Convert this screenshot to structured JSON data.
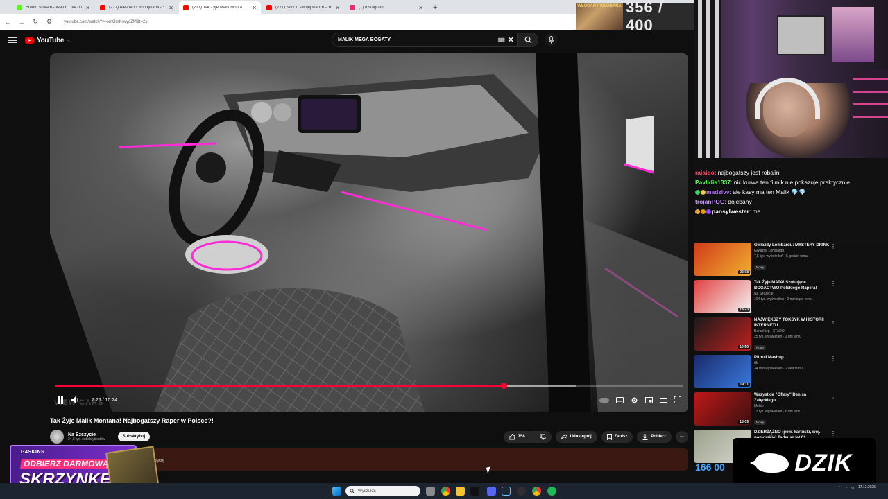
{
  "browser": {
    "tabs": [
      {
        "title": "Franio Stream - Watch Live on Kick",
        "color": "#53fc18",
        "active": false
      },
      {
        "title": "(217) Aleshen x miodykami - YouTube",
        "color": "#ff0000",
        "active": false
      },
      {
        "title": "(217) Tak Żyje Malik Monta...",
        "color": "#ff0000",
        "active": true
      },
      {
        "title": "(217) Nitrz o swojej wadze - YouTube",
        "color": "#ff0000",
        "active": false
      },
      {
        "title": "(1) Instagram",
        "color": "#e1306c",
        "active": false
      }
    ],
    "url": "youtube.com/watch?v=omOmKovydZM&t=2s",
    "new_tab": "+"
  },
  "overlay_counter": {
    "title": "WŁODARY WŁODARA",
    "value": "356 / 400"
  },
  "youtube": {
    "logo_text": "YouTube",
    "logo_country": "PL",
    "search_query": "MALIK MEGA BOGATY",
    "video": {
      "current_time": "7:26 / 10:24",
      "progress": 0.715,
      "watermark": "VIEW CARS",
      "title": "Tak Żyje Malik Montana! Najbogatszy Raper w Polsce?!"
    },
    "channel": {
      "name": "Na Szczycie",
      "subscribers": "24,6 tys. subskrybentów",
      "subscribe_label": "Subskrybuj"
    },
    "actions": {
      "likes": "758",
      "share": "Udostępnij",
      "save": "Zapisz",
      "download": "Pobierz"
    },
    "description_more": "...więcej"
  },
  "chat": [
    {
      "user": "rajaiqo",
      "color": "#ff4f6a",
      "text": ": najbogatszy jest robalini",
      "badges": []
    },
    {
      "user": "Pavlidis1337",
      "color": "#5bff5b",
      "text": ": nic kurwa ten filmik nie pokazuje praktycznie",
      "badges": []
    },
    {
      "user": "madzivv",
      "color": "#b36bff",
      "text": ": ale kasy ma ten Malik 💎💎",
      "badges": [
        "#3ad06a",
        "#f3c742"
      ]
    },
    {
      "user": "trojanPOG",
      "color": "#c690ff",
      "text": ": dojebany",
      "badges": []
    },
    {
      "user": "pansylwester",
      "color": "#ffffff",
      "text": ": ma",
      "badges": [
        "#f3a742",
        "#e0a000",
        "#9146ff"
      ]
    }
  ],
  "recommendations": [
    {
      "title": "Gwiazdy Lombardu: MYSTERY DRINK",
      "channel": "Gwiazdy Lombardu",
      "meta": "7,5 tys. wyświetleń · 5 godzin temu",
      "duration": "22:08",
      "new": "Nowy",
      "c1": "#d13a1a",
      "c2": "#f0b030"
    },
    {
      "title": "Tak Żyje MATA! Szokujące BOGACTWO Polskiego Rapera!",
      "channel": "Na Szczycie",
      "meta": "104 tys. wyświetleń · 2 miesiące temu",
      "duration": "18:23",
      "new": "",
      "c1": "#e04040",
      "c2": "#f5f5f5"
    },
    {
      "title": "NAJWIĘKSZY TOKSYK W HISTORII INTERNETU",
      "channel": "Barankiep - STADO",
      "meta": "25 tys. wyświetleń · 2 dni temu",
      "duration": "19:59",
      "new": "Nowy",
      "c1": "#1a1a1a",
      "c2": "#c02020"
    },
    {
      "title": "Pitbull Mashup",
      "channel": "dk",
      "meta": "34 mln wyświetleń · 2 lata temu",
      "duration": "19:11",
      "new": "",
      "c1": "#1a2a6a",
      "c2": "#3a7adf"
    },
    {
      "title": "Wszystkie \"Ofiary\" Denisa Załęckiego..",
      "channel": "Mehio",
      "meta": "73 tys. wyświetleń · 6 dni temu",
      "duration": "18:09",
      "new": "Nowy",
      "c1": "#c01818",
      "c2": "#3a1010"
    },
    {
      "title": "DZIERŻĄŻNO (pow. kartuski, woj. pomorskie) Tadeusz lat 61",
      "channel": "",
      "meta": "",
      "duration": "",
      "new": "",
      "c1": "#9aa08a",
      "c2": "#d8d8d0"
    }
  ],
  "promo": {
    "brand": "G4SKINS",
    "line1": "ODBIERZ DARMOWĄ",
    "line2": "SKRZYNKĘ!"
  },
  "dzik": {
    "text": "DZIK"
  },
  "view_count_partial": "166 00",
  "taskbar": {
    "search_placeholder": "Wyszukaj",
    "date": "17.12.2025"
  }
}
